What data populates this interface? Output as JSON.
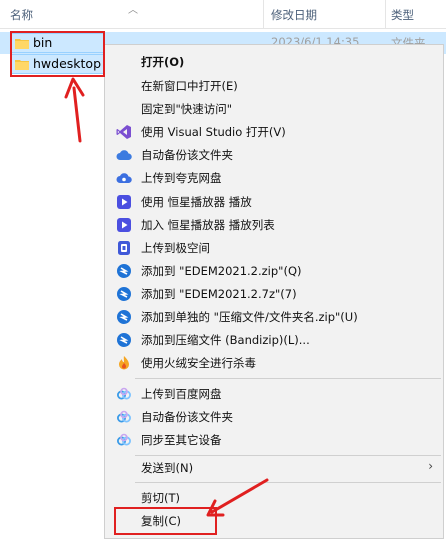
{
  "header": {
    "col_name": "名称",
    "col_date": "修改日期",
    "col_type": "类型"
  },
  "row": {
    "date": "2023/6/1 14:35",
    "type": "文件夹"
  },
  "files": [
    {
      "name": "bin"
    },
    {
      "name": "hwdesktop"
    }
  ],
  "menu": {
    "items": [
      {
        "label": "打开(O)",
        "icon": "none"
      },
      {
        "label": "在新窗口中打开(E)",
        "icon": "none"
      },
      {
        "label": "固定到\"快速访问\"",
        "icon": "none"
      },
      {
        "label": "使用 Visual Studio 打开(V)",
        "icon": "visual-studio-icon"
      },
      {
        "label": "自动备份该文件夹",
        "icon": "cloud-icon"
      },
      {
        "label": "上传到夸克网盘",
        "icon": "quark-cloud-icon"
      },
      {
        "label": "使用 恒星播放器 播放",
        "icon": "player-icon"
      },
      {
        "label": "加入 恒星播放器 播放列表",
        "icon": "player-icon"
      },
      {
        "label": "上传到极空间",
        "icon": "zspace-icon"
      },
      {
        "label": "添加到 \"EDEM2021.2.zip\"(Q)",
        "icon": "bandizip-icon"
      },
      {
        "label": "添加到 \"EDEM2021.2.7z\"(7)",
        "icon": "bandizip-icon"
      },
      {
        "label": "添加到单独的 \"压缩文件/文件夹名.zip\"(U)",
        "icon": "bandizip-icon"
      },
      {
        "label": "添加到压缩文件 (Bandizip)(L)...",
        "icon": "bandizip-icon"
      },
      {
        "label": "使用火绒安全进行杀毒",
        "icon": "huorong-icon"
      },
      {
        "label": "上传到百度网盘",
        "icon": "baidu-cloud-icon"
      },
      {
        "label": "自动备份该文件夹",
        "icon": "baidu-cloud-icon"
      },
      {
        "label": "同步至其它设备",
        "icon": "baidu-cloud-icon"
      },
      {
        "label": "发送到(N)",
        "icon": "none"
      },
      {
        "label": "剪切(T)",
        "icon": "none"
      },
      {
        "label": "复制(C)",
        "icon": "none"
      }
    ]
  },
  "colors": {
    "selection": "#cce8ff",
    "annotation": "#e02020",
    "menu_bg": "#f2f2f2"
  }
}
